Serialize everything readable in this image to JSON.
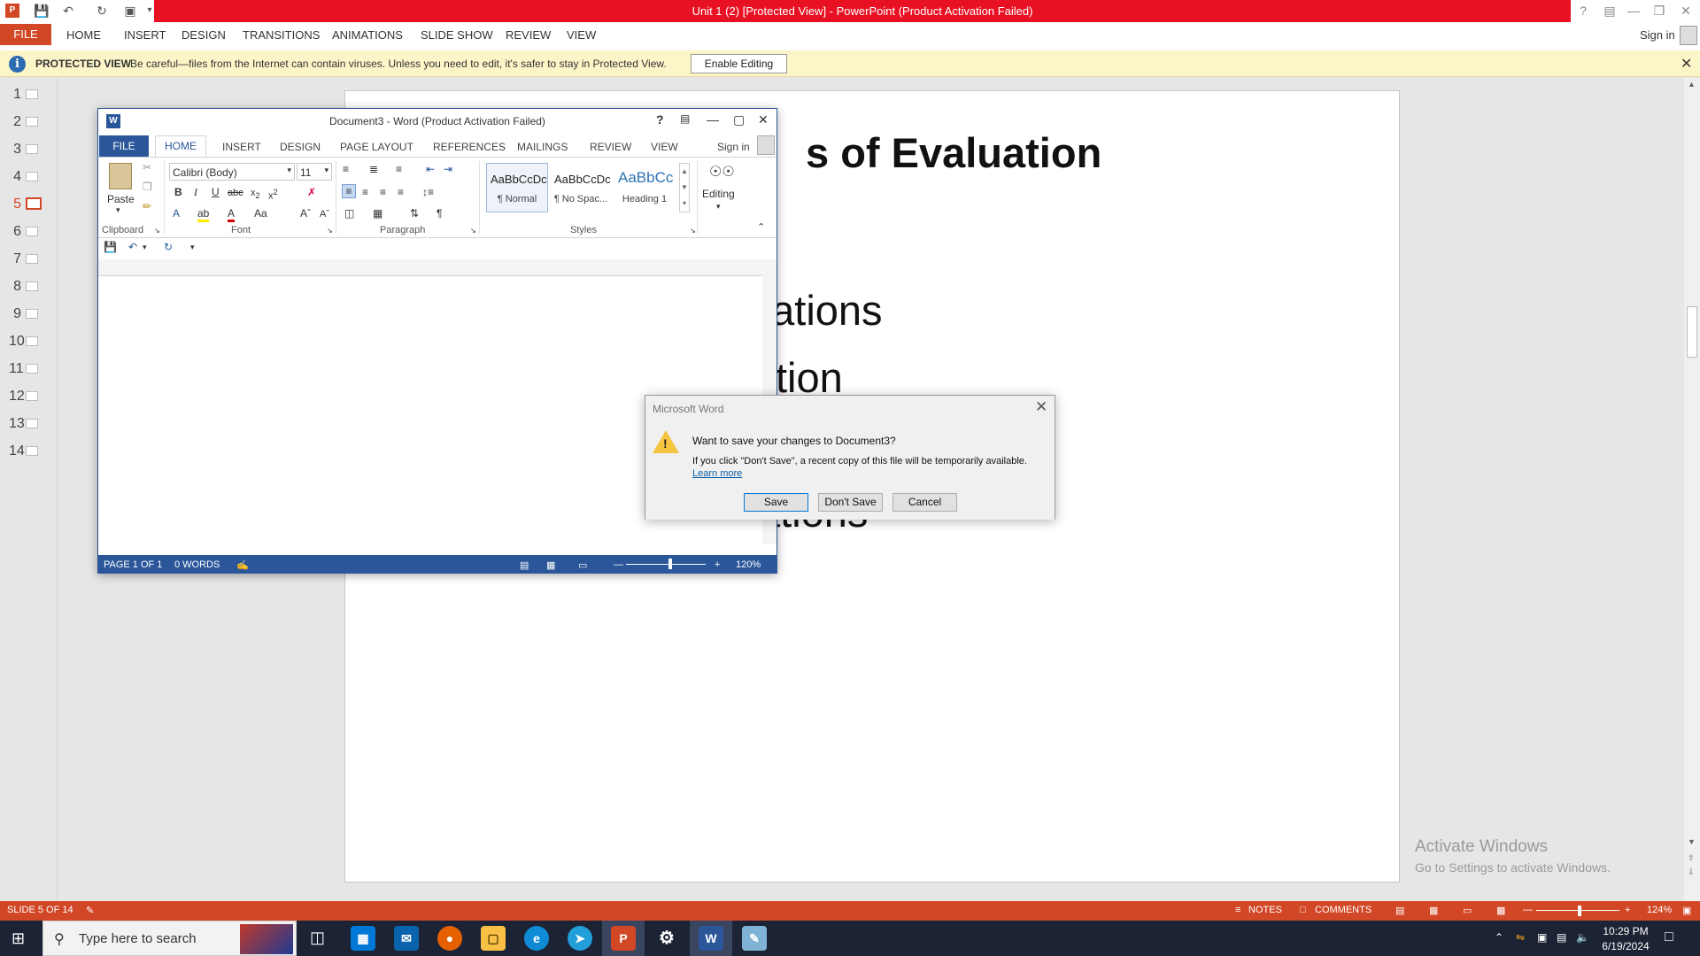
{
  "powerpoint": {
    "title": "Unit 1 (2) [Protected View] - PowerPoint (Product Activation Failed)",
    "sign_in": "Sign in",
    "tabs": [
      "FILE",
      "HOME",
      "INSERT",
      "DESIGN",
      "TRANSITIONS",
      "ANIMATIONS",
      "SLIDE SHOW",
      "REVIEW",
      "VIEW"
    ],
    "protected_view": {
      "label": "PROTECTED VIEW",
      "message": "Be careful—files from the Internet can contain viruses. Unless you need to edit, it's safer to stay in Protected View.",
      "button": "Enable Editing"
    },
    "slide_numbers": [
      "1",
      "2",
      "3",
      "4",
      "5",
      "6",
      "7",
      "8",
      "9",
      "10",
      "11",
      "12",
      "13",
      "14"
    ],
    "selected_slide": "5",
    "slide_text": {
      "title_fragment": "s of Evaluation",
      "line1": "uations",
      "line2": "tion",
      "line3": "ations"
    },
    "watermark": {
      "line1": "Activate Windows",
      "line2": "Go to Settings to activate Windows."
    },
    "status": {
      "slide_indicator": "SLIDE 5 OF 14",
      "notes": "NOTES",
      "comments": "COMMENTS",
      "zoom": "124%"
    }
  },
  "word": {
    "title": "Document3 - Word (Product Activation Failed)",
    "sign_in": "Sign in",
    "tabs": [
      "FILE",
      "HOME",
      "INSERT",
      "DESIGN",
      "PAGE LAYOUT",
      "REFERENCES",
      "MAILINGS",
      "REVIEW",
      "VIEW"
    ],
    "font_name": "Calibri (Body)",
    "font_size": "11",
    "paste_label": "Paste",
    "editing_label": "Editing",
    "groups": {
      "clipboard": "Clipboard",
      "font": "Font",
      "paragraph": "Paragraph",
      "styles": "Styles"
    },
    "styles": [
      {
        "preview": "AaBbCcDc",
        "name": "¶ Normal"
      },
      {
        "preview": "AaBbCcDc",
        "name": "¶ No Spac..."
      },
      {
        "preview": "AaBbCc",
        "name": "Heading 1"
      }
    ],
    "status": {
      "page": "PAGE 1 OF 1",
      "words": "0 WORDS",
      "zoom": "120%"
    }
  },
  "dialog": {
    "title": "Microsoft Word",
    "question": "Want to save your changes to Document3?",
    "info": "If you click \"Don't Save\", a recent copy of this file will be temporarily available.",
    "learn_more": "Learn more",
    "buttons": {
      "save": "Save",
      "dont_save": "Don't Save",
      "cancel": "Cancel"
    }
  },
  "taskbar": {
    "search_placeholder": "Type here to search",
    "time": "10:29 PM",
    "date": "6/19/2024"
  },
  "colors": {
    "ppt_accent": "#d24726",
    "word_accent": "#2b579a",
    "title_red": "#e81123"
  }
}
